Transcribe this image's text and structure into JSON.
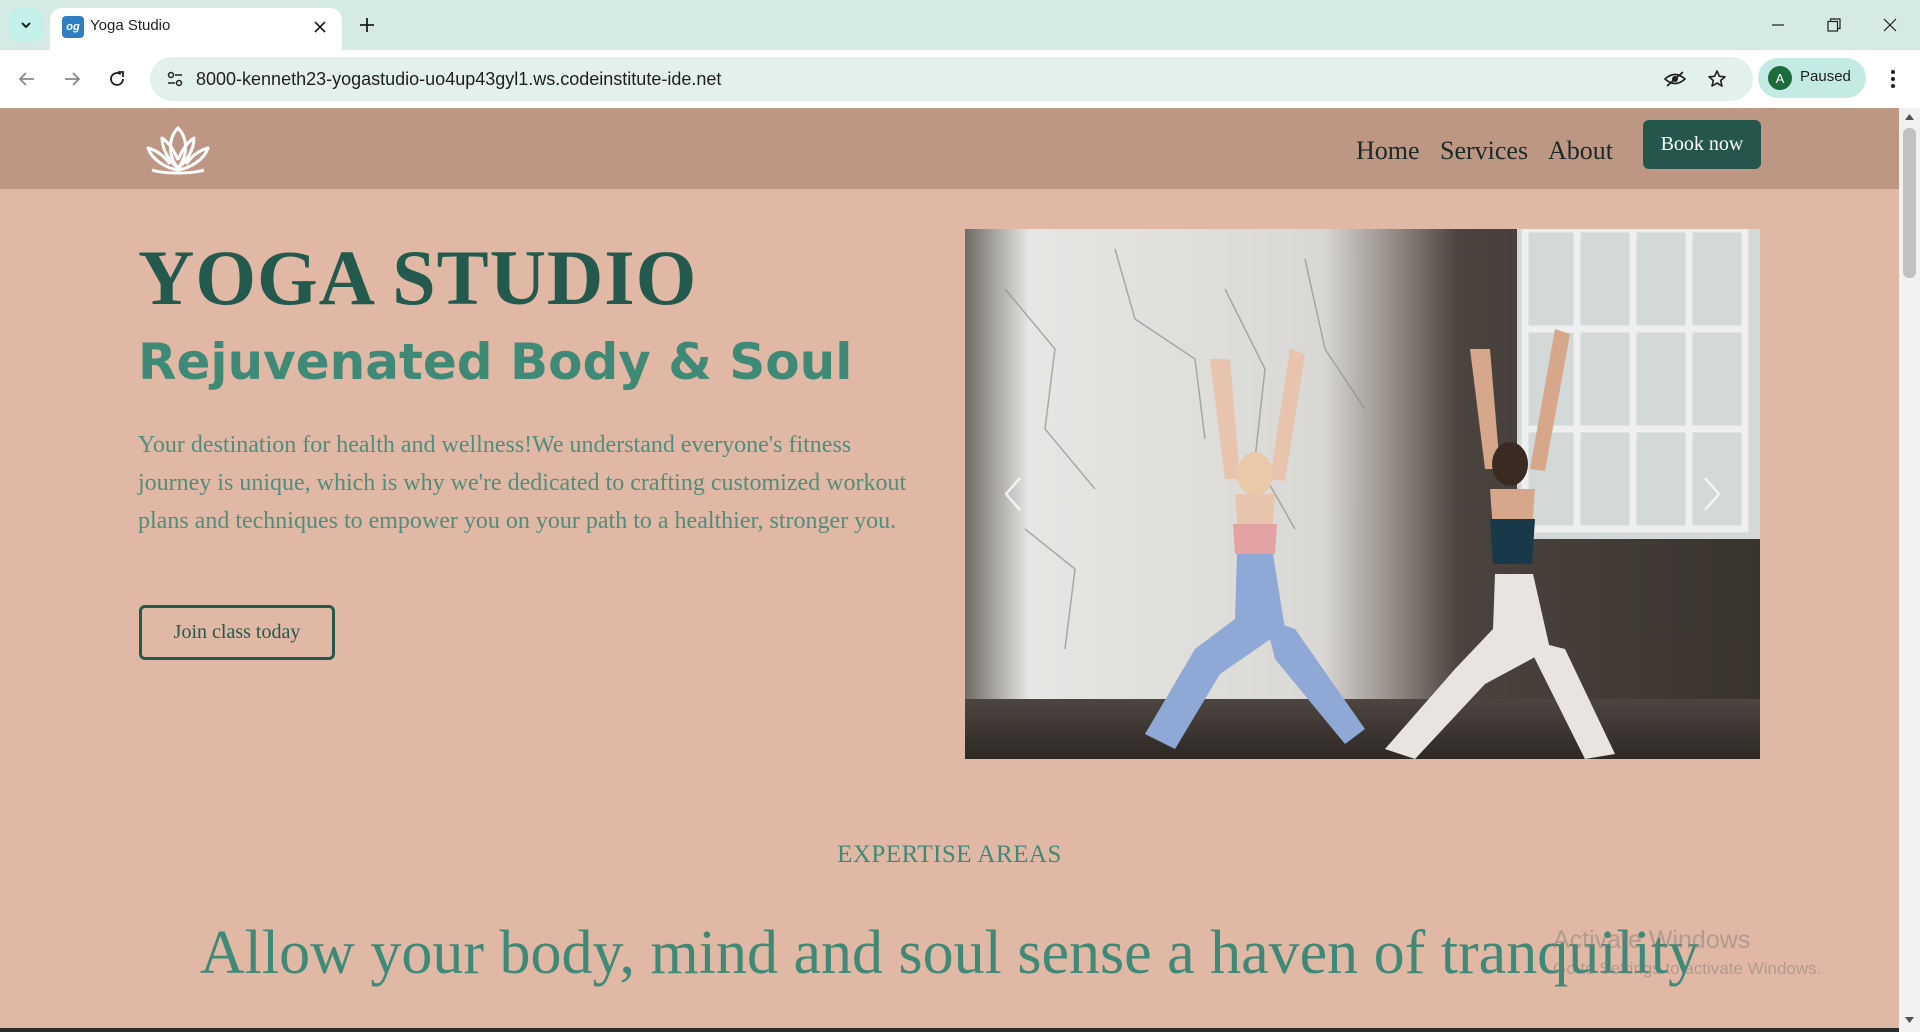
{
  "browser": {
    "tab_title": "Yoga Studio",
    "favicon_text": "og",
    "url": "8000-kenneth23-yogastudio-uo4up43gyl1.ws.codeinstitute-ide.net",
    "profile_initial": "A",
    "profile_status": "Paused"
  },
  "nav": {
    "links": [
      "Home",
      "Services",
      "About"
    ],
    "book_label": "Book now"
  },
  "hero": {
    "title": "YOGA STUDIO",
    "subtitle": "Rejuvenated Body & Soul",
    "description": "Your destination for health and wellness!We understand everyone's fitness journey is unique, which is why we're dedicated to crafting customized workout plans and techniques to empower you on your path to a healthier, stronger you.",
    "cta_label": "Join class today"
  },
  "expertise": {
    "label": "EXPERTISE AREAS",
    "tagline": "Allow your body, mind and soul sense a haven of tranquility"
  },
  "watermark": {
    "title": "Activate Windows",
    "subtitle": "Go to Settings to activate Windows."
  },
  "colors": {
    "page_bg": "#e0b8a5",
    "nav_bg": "#bd9784",
    "accent": "#24564c",
    "text_green": "#3e8a77"
  }
}
